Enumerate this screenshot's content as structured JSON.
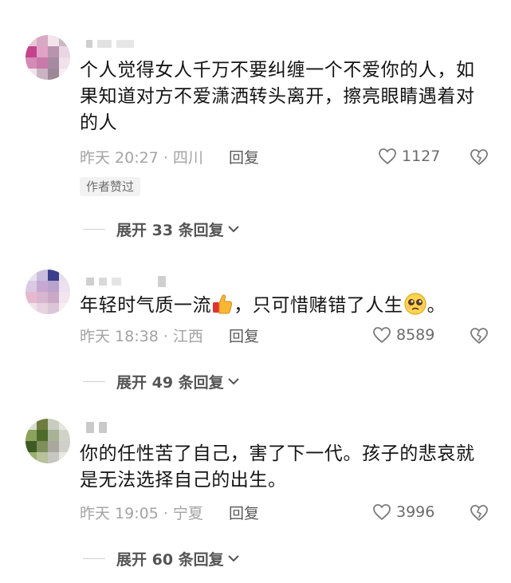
{
  "comments": [
    {
      "text": "个人觉得女人千万不要纠缠一个不爱你的人，如果知道对方不爱潇洒转头离开，擦亮眼睛遇着对的人",
      "time_location": "昨天 20:27 · 四川",
      "reply_label": "回复",
      "likes": "1127",
      "author_badge": "作者赞过",
      "expand_label": "展开 33 条回复"
    },
    {
      "text_part1": "年轻时气质一流",
      "text_part2": "，只可惜赌错了人生",
      "text_part3": "。",
      "time_location": "昨天 18:38 · 江西",
      "reply_label": "回复",
      "likes": "8589",
      "expand_label": "展开 49 条回复"
    },
    {
      "text": "你的任性苦了自己，害了下一代。孩子的悲哀就是无法选择自己的出生。",
      "time_location": "昨天 19:05 · 宁夏",
      "reply_label": "回复",
      "likes": "3996",
      "expand_label": "展开 60 条回复"
    }
  ],
  "icons": {
    "like": "heart-outline-icon",
    "dislike": "broken-heart-outline-icon",
    "expand": "chevron-down-icon",
    "emoji1": "thumbs-up-emoji",
    "emoji2": "pleading-face-emoji"
  },
  "colors": {
    "text": "#141414",
    "meta": "#a3a3a3",
    "reply": "#595959",
    "badge_bg": "#f2f2f2"
  }
}
